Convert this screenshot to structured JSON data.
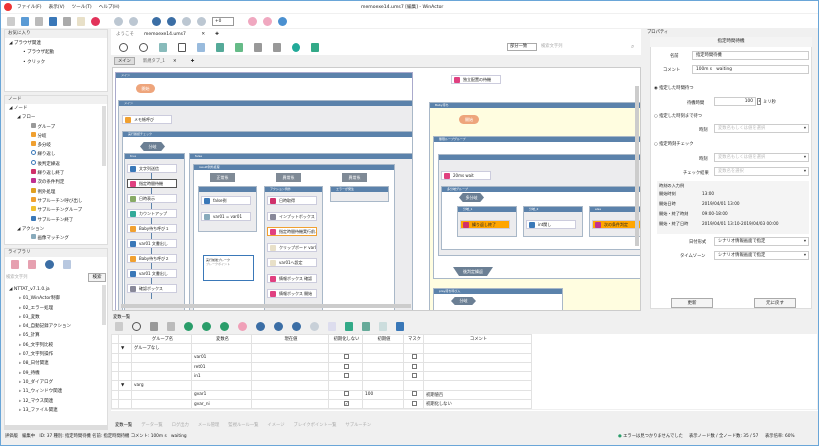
{
  "window": {
    "title": "memoexe14.ums7 [編集] - WinActor"
  },
  "menu": [
    "ファイル(F)",
    "表示(V)",
    "ツール(T)",
    "ヘルプ(H)"
  ],
  "toolbar": {
    "speed": "+0"
  },
  "favorites": {
    "title": "お気に入り",
    "items": [
      "ブラウザ関連",
      "ブラウザ起動",
      "クリック"
    ]
  },
  "nodes": {
    "title": "ノード",
    "items": [
      "ノード",
      "フロー",
      "グループ",
      "分岐",
      "多分岐",
      "繰り返し",
      "後判定繰返",
      "繰り返し終了",
      "次の条件判定",
      "例外処理",
      "サブルーチン呼び出し",
      "サブルーチングループ",
      "サブルーチン終了",
      "アクション",
      "画像マッチング"
    ]
  },
  "library": {
    "title": "ライブラリ",
    "search_placeholder": "検索文字列",
    "search_button": "検索",
    "items": [
      "NTTAT_v7.1.0.ja",
      "01_WinActor制御",
      "02_エラー処理",
      "03_変数",
      "04_自動記録アクション",
      "05_計算",
      "06_文字列比較",
      "07_文字列操作",
      "08_日付関連",
      "09_待機",
      "10_ダイアログ",
      "11_ウィンドウ関連",
      "12_マウス関連",
      "13_ファイル関連"
    ]
  },
  "doc_tabs": [
    "ようこそ",
    "memoexe14.ums7"
  ],
  "flow_toolbar": {
    "match_mode": "部分一致",
    "search_placeholder": "検索文字列"
  },
  "sub_tabs": [
    "メイン",
    "新規タブ_1"
  ],
  "flow": {
    "start": "開始",
    "main_group": "メイン",
    "memo": "メモ帳呼び",
    "check_group": "実行確認チェック",
    "branch": "分岐",
    "true": "true",
    "false": "false",
    "true_nodes": [
      "文字列送信",
      "指定時間待機",
      "日時表示",
      "カウントアップ",
      "Baby待ち呼び１",
      "var01 文書出し",
      "Baby待ち呼び２",
      "var01 文書出し",
      "確認ボックス"
    ],
    "exc_group": "result例外処理",
    "lanes": [
      "正常系",
      "異常系",
      "異常系"
    ],
    "lane_groups": [
      "",
      "アクション例外",
      "エラーが発生"
    ],
    "normal_nodes": [
      "false例",
      "var01 = var01"
    ],
    "exc_nodes": [
      "日時取得",
      "インプットボックス",
      "指定時間待機実行前...",
      "クリップボード var01...",
      "var01へ設定",
      "情報ボックス 確認",
      "情報ボックス 開始"
    ],
    "note": "実行前後ブレーク",
    "note_sub": "ブレークポイント",
    "independent": "独立配置の待機",
    "baby": "Baby待ち",
    "start2": "開始",
    "loop_group": "無限ループグループ",
    "wait20": "20ms wait",
    "multi_group": "多分岐グループ",
    "multi": "多分岐",
    "cases": [
      "分岐_1",
      "分岐_2",
      "else"
    ],
    "case_nodes": [
      "繰り返し終了",
      "int関し",
      "次の条件判定"
    ],
    "repeat_end": "後判定繰返",
    "group2": "play待ち呼び入",
    "branch2": "分岐"
  },
  "properties": {
    "title": "プロパティ",
    "header": "指定時間待機",
    "name_label": "名前",
    "name_value": "指定時間待機",
    "comment_label": "コメント",
    "comment_value": "100m s　waiting",
    "opt1": "指定した時間待つ",
    "wait_label": "待機時間",
    "wait_value": "100",
    "wait_unit": "ミリ秒",
    "opt2": "指定した時刻まで待つ",
    "time_label": "時刻",
    "time_placeholder": "変数名もしくは値を選択",
    "opt3": "指定時刻チェック",
    "time2_label": "時刻",
    "time2_placeholder": "変数名もしくは値を選択",
    "result_label": "チェック結果",
    "result_placeholder": "変数名を選択",
    "examples_title": "時刻の入力例",
    "examples": [
      [
        "開始時刻",
        "13:00"
      ],
      [
        "開始日時",
        "2019/04/01 13:00"
      ],
      [
        "開始・終了時刻",
        "09:00-18:00"
      ],
      [
        "開始・終了日時",
        "2019/04/01 13:10-2019/04/03 00:00"
      ]
    ],
    "date_label": "日付形式",
    "date_value": "シナリオ情報画面で指定",
    "tz_label": "タイムゾーン",
    "tz_value": "シナリオ情報画面で指定",
    "update": "更新",
    "revert": "元に戻す"
  },
  "variables": {
    "title": "変数一覧",
    "columns": [
      "グループ名",
      "変数名",
      "現在値",
      "初期化しない",
      "初期値",
      "マスク",
      "コメント"
    ],
    "groups": [
      {
        "name": "グループなし",
        "rows": [
          {
            "name": "var01",
            "value": "",
            "noinit": false,
            "init": "",
            "mask": false,
            "comment": ""
          },
          {
            "name": "ret01",
            "value": "",
            "noinit": false,
            "init": "",
            "mask": false,
            "comment": ""
          },
          {
            "name": "in1",
            "value": "",
            "noinit": false,
            "init": "",
            "mask": false,
            "comment": ""
          }
        ]
      },
      {
        "name": "varg",
        "rows": [
          {
            "name": "gvar1",
            "value": "",
            "noinit": false,
            "init": "100",
            "mask": false,
            "comment": "初期値百"
          },
          {
            "name": "gvar_ni",
            "value": "",
            "noinit": true,
            "init": "",
            "mask": false,
            "comment": "初期化しない"
          }
        ]
      }
    ]
  },
  "bottom_tabs": [
    "変数一覧",
    "データ一覧",
    "ログ出力",
    "メール管理",
    "監視ルール一覧",
    "イメージ",
    "ブレイクポイント一覧",
    "サブルーチン"
  ],
  "status": {
    "left": "評価版　編集中　ID: 37 種別: 指定時間待機 名前: 指定時間待機 コメント: 100m s　waiting",
    "errors": "エラーは見つかりませんでした",
    "node_count": "表示ノード数 / 全ノード数: 35 / 57",
    "zoom": "表示倍率: 60%"
  }
}
